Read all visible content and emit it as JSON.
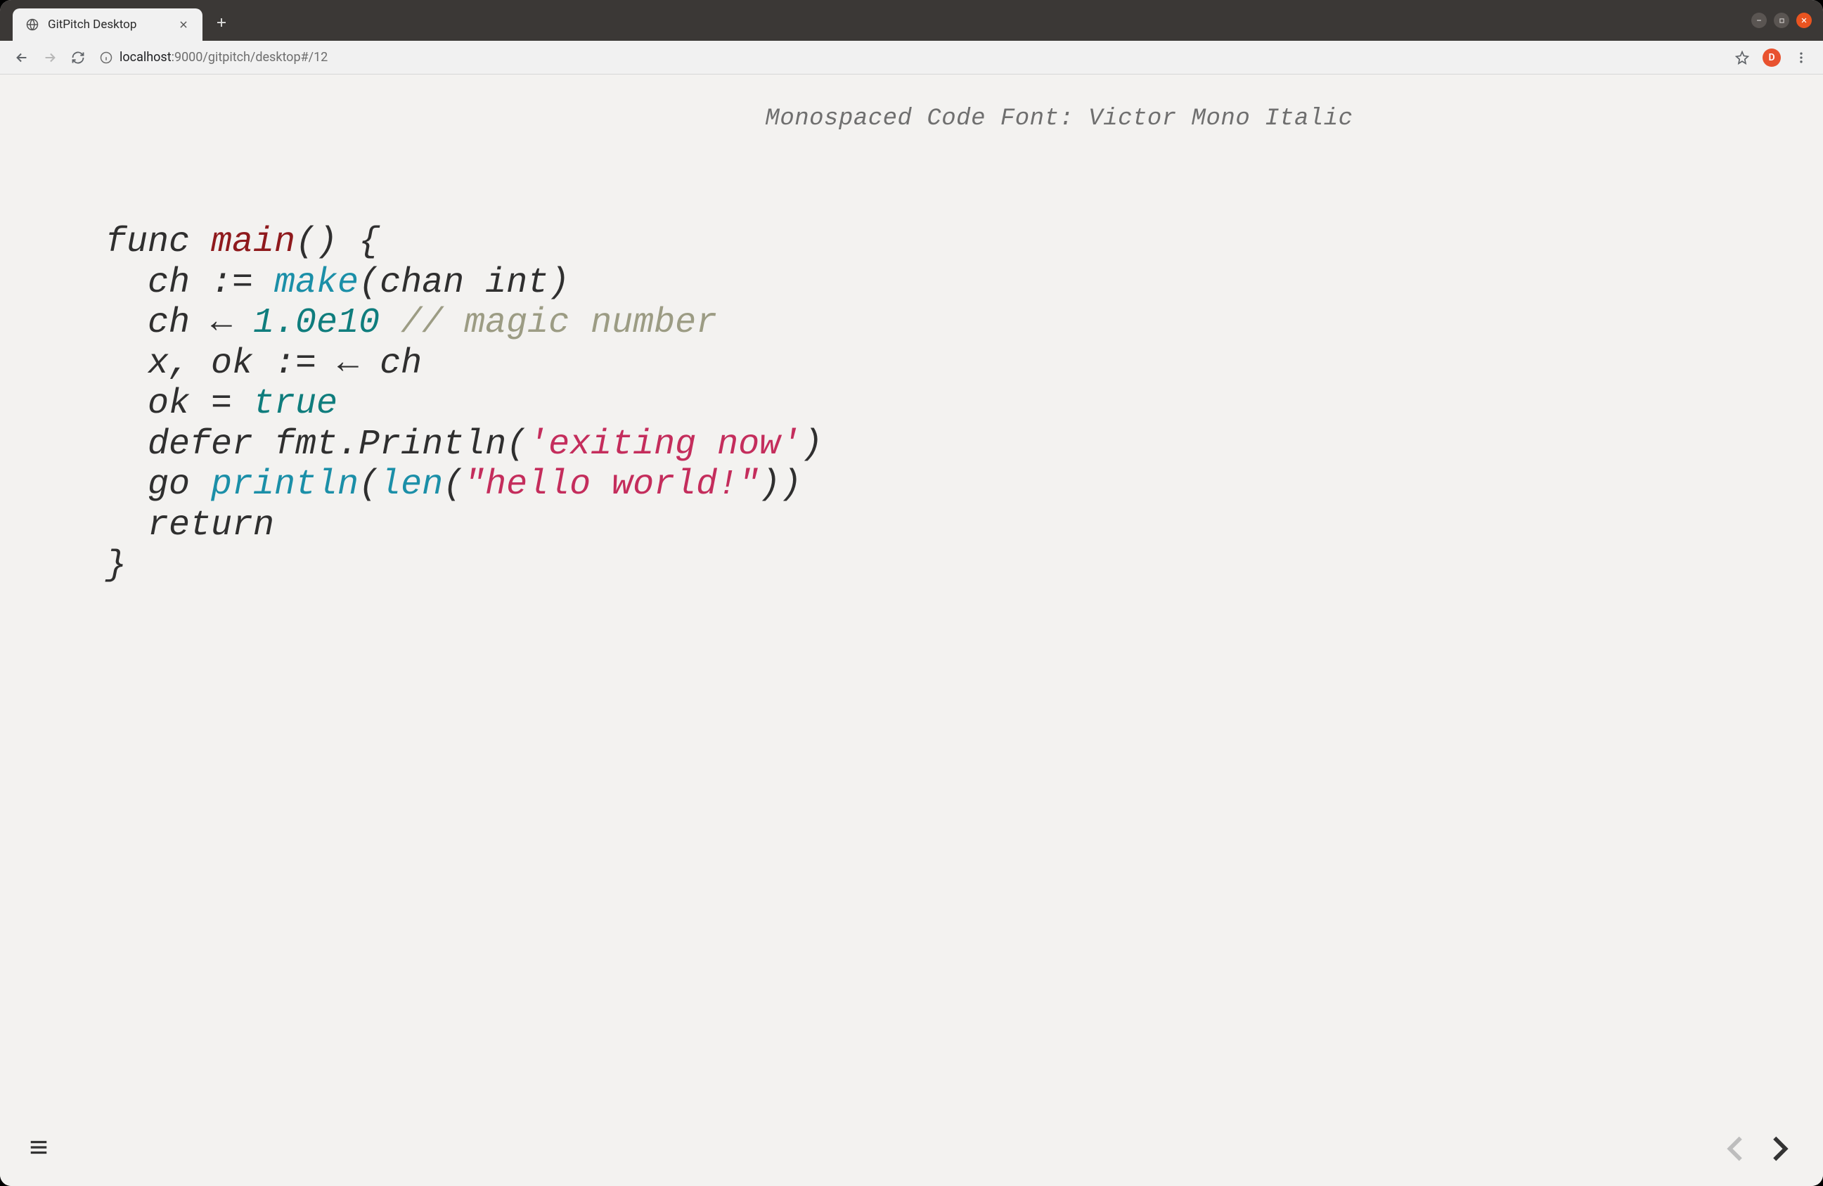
{
  "window": {
    "tab_title": "GitPitch Desktop",
    "new_tab_tooltip": "New Tab"
  },
  "toolbar": {
    "url_host": "localhost",
    "url_port": ":9000",
    "url_path": "/gitpitch/desktop#/12",
    "avatar_initial": "D"
  },
  "slide": {
    "title": "Monospaced Code Font: Victor Mono Italic",
    "code": {
      "l1_func": "func ",
      "l1_main": "main",
      "l1_rest": "() {",
      "l2_a": "  ch := ",
      "l2_make": "make",
      "l2_b": "(chan int)",
      "l3_a": "  ch ← ",
      "l3_num": "1.0e10",
      "l3_sp": " ",
      "l3_cmt": "// magic number",
      "l4": "  x, ok := ← ch",
      "l5_a": "  ok = ",
      "l5_true": "true",
      "l6_a": "  defer fmt.Println(",
      "l6_str": "'exiting now'",
      "l6_b": ")",
      "l7_a": "  go ",
      "l7_println": "println",
      "l7_b": "(",
      "l7_len": "len",
      "l7_c": "(",
      "l7_str": "\"hello world!\"",
      "l7_d": "))",
      "l8": "  return",
      "l9": "}"
    }
  }
}
